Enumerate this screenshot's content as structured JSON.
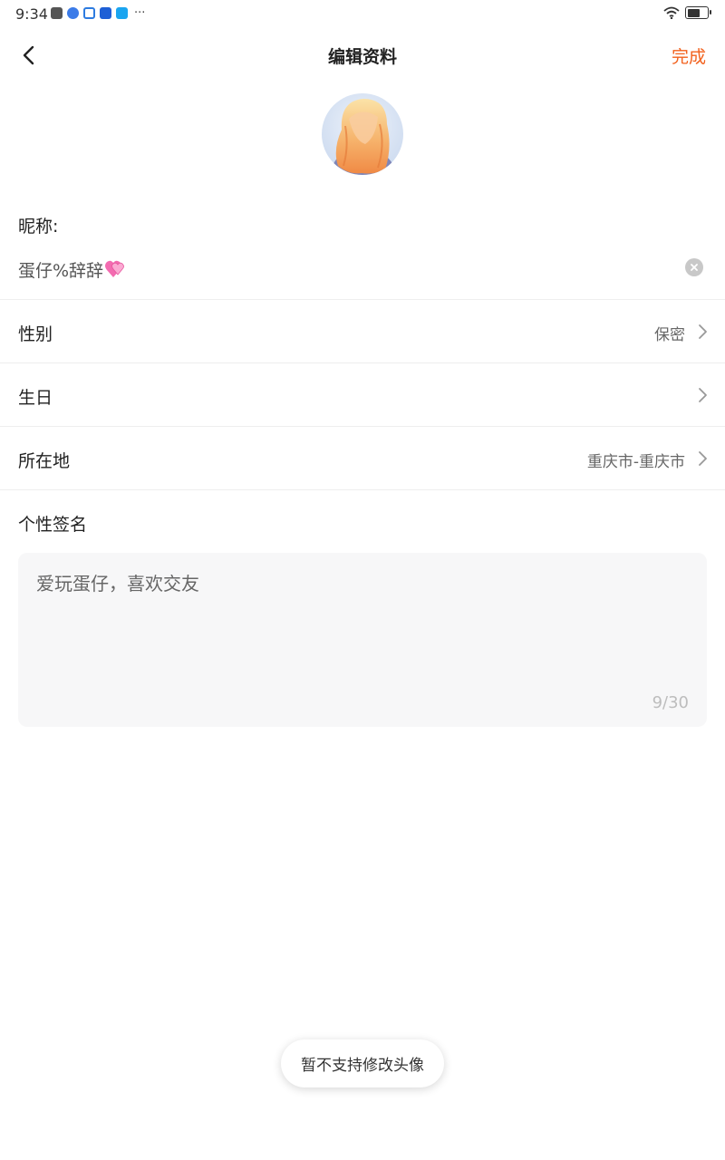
{
  "status_bar": {
    "time": "9:34",
    "more": "···",
    "app_icons": [
      {
        "icon": "app-icon-1",
        "color": "#555555"
      },
      {
        "icon": "app-icon-2",
        "color": "#3b7be8"
      },
      {
        "icon": "app-icon-3",
        "color": "#2d7be0"
      },
      {
        "icon": "app-icon-4",
        "color": "#1e5fd6"
      },
      {
        "icon": "app-icon-5",
        "color": "#1aa5f0"
      }
    ]
  },
  "nav": {
    "title": "编辑资料",
    "done_label": "完成",
    "accent_color": "#f2611d"
  },
  "profile": {
    "nickname_label": "昵称:",
    "nickname_value": "蛋仔%辞辞",
    "rows": [
      {
        "label": "性别",
        "value": "保密"
      },
      {
        "label": "生日",
        "value": ""
      },
      {
        "label": "所在地",
        "value": "重庆市-重庆市"
      }
    ],
    "signature_label": "个性签名",
    "signature_text": "爱玩蛋仔，喜欢交友",
    "signature_count": "9/30"
  },
  "toast": {
    "text": "暂不支持修改头像"
  }
}
